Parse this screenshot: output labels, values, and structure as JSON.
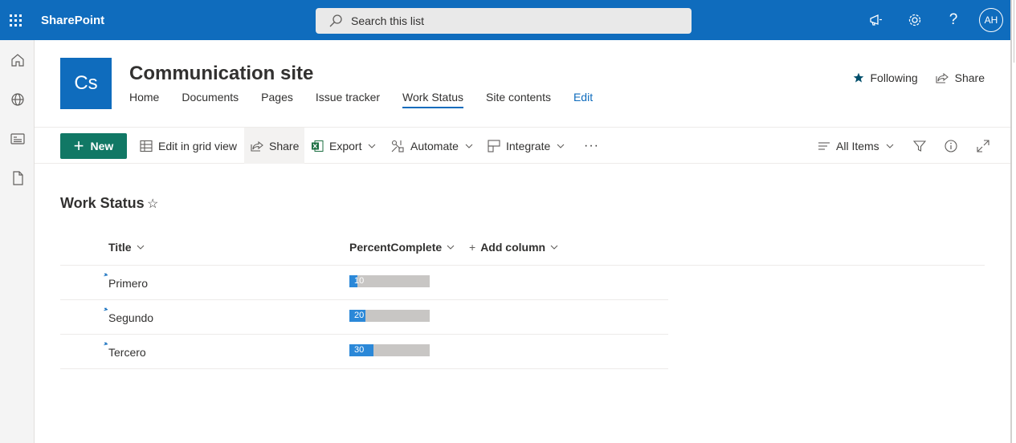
{
  "suite": {
    "brand": "SharePoint",
    "search_placeholder": "Search this list",
    "user_initials": "AH"
  },
  "site": {
    "logo_text": "Cs",
    "title": "Communication site",
    "nav": [
      "Home",
      "Documents",
      "Pages",
      "Issue tracker",
      "Work Status",
      "Site contents",
      "Edit"
    ],
    "active_nav": "Work Status",
    "following_label": "Following",
    "share_label": "Share"
  },
  "commandbar": {
    "new_label": "New",
    "edit_grid_label": "Edit in grid view",
    "share_label": "Share",
    "export_label": "Export",
    "automate_label": "Automate",
    "integrate_label": "Integrate",
    "more_label": "···",
    "view_label": "All Items"
  },
  "list": {
    "title": "Work Status",
    "columns": {
      "title": "Title",
      "percent": "PercentComplete",
      "add": "Add column"
    },
    "rows": [
      {
        "title": "Primero",
        "percent": 10,
        "percent_label": "10"
      },
      {
        "title": "Segundo",
        "percent": 20,
        "percent_label": "20"
      },
      {
        "title": "Tercero",
        "percent": 30,
        "percent_label": "30"
      }
    ]
  },
  "colors": {
    "suitebar": "#0f6cbd",
    "new_button": "#117865",
    "progress_fill": "#2b88d8",
    "progress_track": "#c8c6c4"
  }
}
